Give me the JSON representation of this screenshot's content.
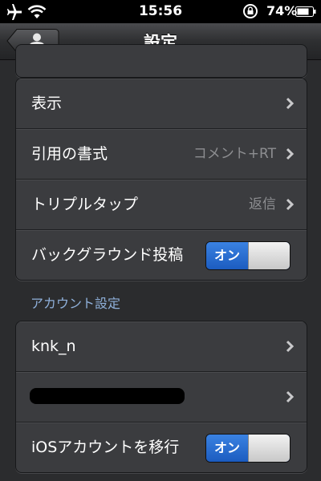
{
  "status_bar": {
    "time": "15:56",
    "battery_percent": "74%",
    "icons": [
      "airplane-icon",
      "wifi-icon",
      "rotation-lock-icon",
      "battery-icon"
    ]
  },
  "nav": {
    "title": "設定",
    "back_icon": "user-icon"
  },
  "group1": {
    "rows": [
      {
        "label": "表示",
        "value": "",
        "type": "disclosure"
      },
      {
        "label": "引用の書式",
        "value": "コメント+RT",
        "type": "disclosure"
      },
      {
        "label": "トリプルタップ",
        "value": "返信",
        "type": "disclosure"
      },
      {
        "label": "バックグラウンド投稿",
        "type": "toggle",
        "toggle_text": "オン",
        "on": true
      }
    ]
  },
  "account_section": {
    "header": "アカウント設定",
    "rows": [
      {
        "label": "knk_n",
        "type": "disclosure"
      },
      {
        "label": "",
        "type": "disclosure",
        "redacted": true
      },
      {
        "label": "iOSアカウントを移行",
        "type": "toggle",
        "toggle_text": "オン",
        "on": true
      }
    ]
  },
  "colors": {
    "background": "#2b2c2e",
    "cell": "#3b3c3f",
    "toggle_on": "#1f60c4",
    "section_header": "#8fb0da",
    "value_text": "#8d8e91"
  }
}
